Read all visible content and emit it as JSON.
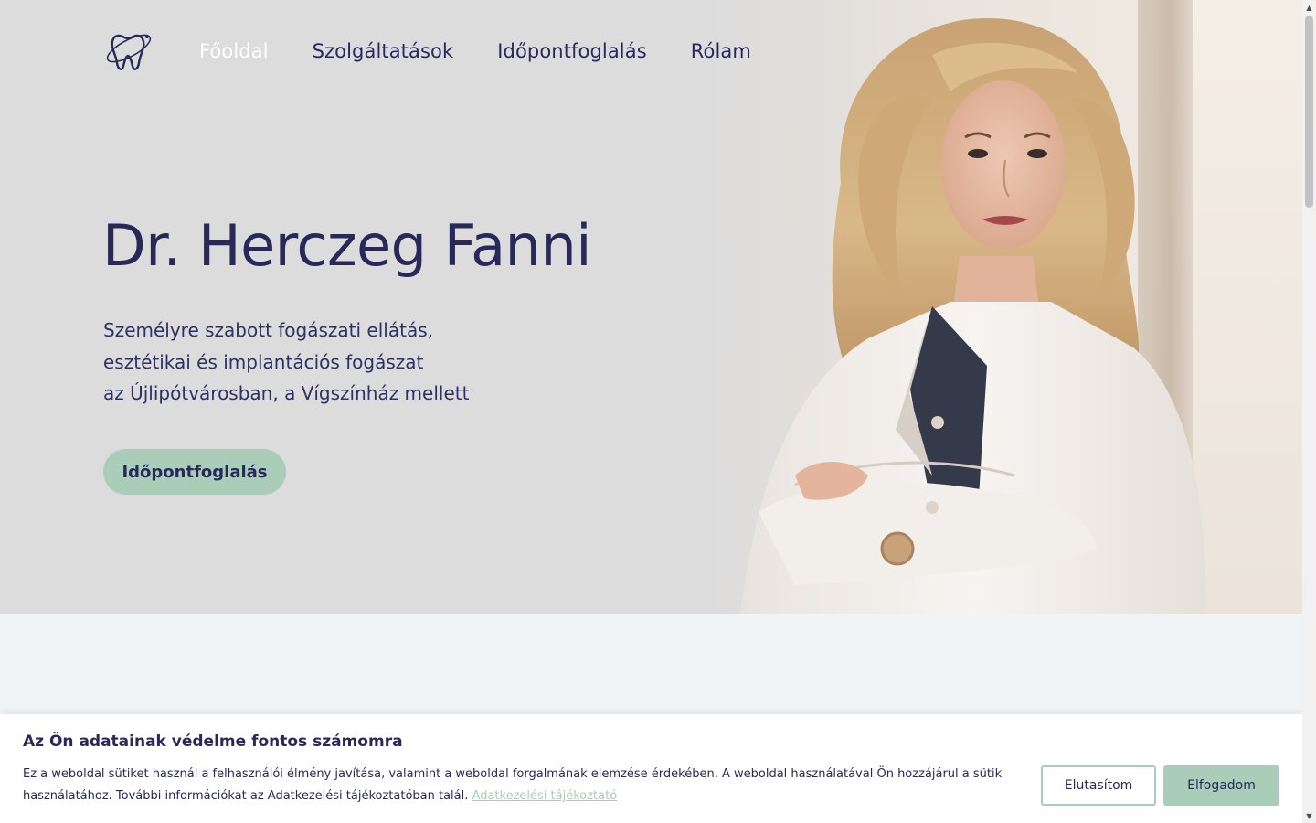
{
  "nav": {
    "logo_icon": "tooth-with-orbit-icon",
    "items": [
      {
        "label": "Főoldal",
        "active": true
      },
      {
        "label": "Szolgáltatások",
        "active": false
      },
      {
        "label": "Időpontfoglalás",
        "active": false
      },
      {
        "label": "Rólam",
        "active": false
      }
    ]
  },
  "hero": {
    "title": "Dr. Herczeg Fanni",
    "subtitle_lines": [
      "Személyre szabott fogászati ellátás,",
      "esztétikai és implantációs fogászat",
      "az Újlipótvárosban, a Vígszínház mellett"
    ],
    "cta_label": "Időpontfoglalás"
  },
  "cookie": {
    "title": "Az Ön adatainak védelme fontos számomra",
    "text_line1": "Ez a weboldal sütiket használ a felhasználói élmény javítása, valamint a weboldal forgalmának elemzése érdekében. A weboldal használatával Ön hozzájárul a sütik",
    "text_line2": "használatához. További információkat az Adatkezelési tájékoztatóban talál.",
    "link_label": "Adatkezelési tájékoztató",
    "reject_label": "Elutasítom",
    "accept_label": "Elfogadom"
  },
  "colors": {
    "primary_text": "#28295a",
    "accent_green": "#a9cdb9",
    "hero_bg": "#dcdcdd",
    "section_bg": "#f1f4f7"
  }
}
